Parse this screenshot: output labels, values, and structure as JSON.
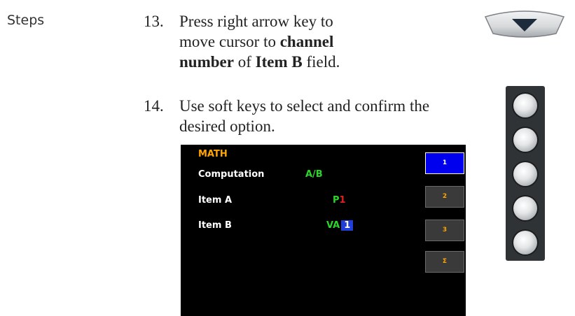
{
  "section_label": "Steps",
  "steps": [
    {
      "number": "13.",
      "parts": [
        "Press right arrow key to move cursor to ",
        "channel number",
        " of ",
        "Item B",
        " field."
      ]
    },
    {
      "number": "14.",
      "text": "Use soft keys to select and confirm the desired option."
    }
  ],
  "screen": {
    "title": "MATH",
    "rows": [
      {
        "label": "Computation",
        "value": "A/B"
      },
      {
        "label": "Item A",
        "value_prefix": "P",
        "value_suffix": "1"
      },
      {
        "label": "Item B",
        "value_prefix": "VA",
        "value_cursor": "1"
      }
    ],
    "softkeys": [
      {
        "label": "1",
        "active": true
      },
      {
        "label": "2",
        "active": false
      },
      {
        "label": "3",
        "active": false
      },
      {
        "label": "Σ",
        "active": false
      }
    ]
  },
  "colors": {
    "screen_title": "#ffa500",
    "value_green": "#2bd62b",
    "value_red": "#e02020",
    "cursor_highlight": "#1f3fd6",
    "active_softkey": "#0000ee"
  },
  "icons": [
    "down-arrow-key-icon",
    "soft-key-icon"
  ]
}
